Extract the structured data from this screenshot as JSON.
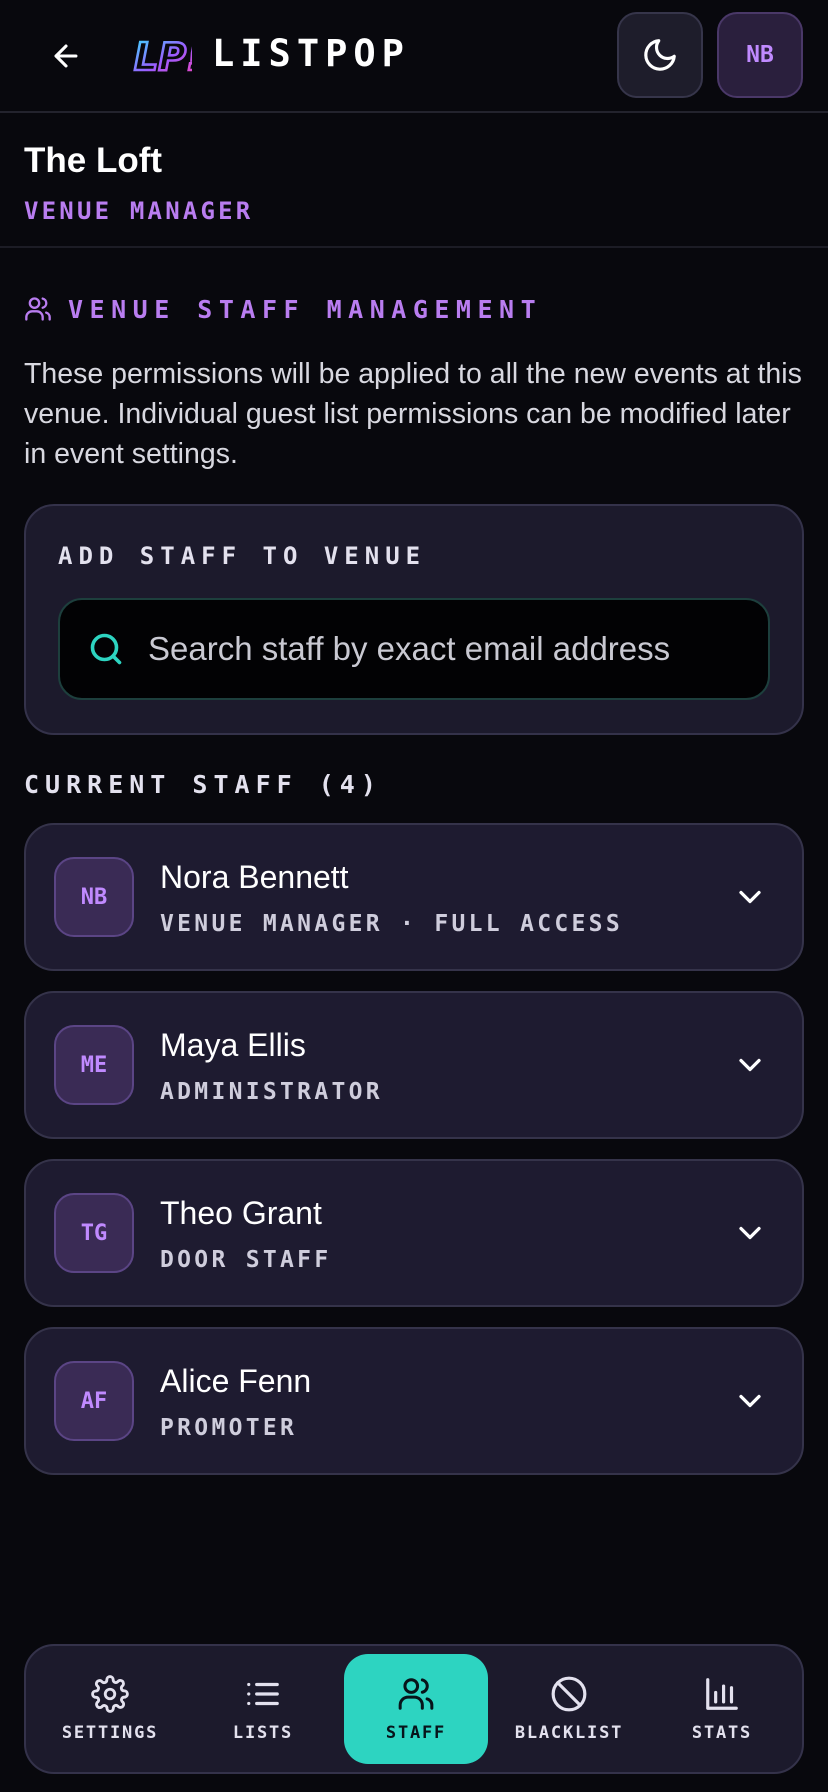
{
  "header": {
    "logo_mark": "LP!",
    "logo_text": "LISTPOP",
    "avatar_initials": "NB",
    "icons": {
      "back": "arrow-left-icon",
      "theme": "moon-icon"
    }
  },
  "venue": {
    "name": "The Loft",
    "role": "VENUE MANAGER"
  },
  "staff_section": {
    "title": "VENUE STAFF MANAGEMENT",
    "description": "These permissions will be applied to all the new events at this venue. Individual guest list permissions can be modified later in event settings.",
    "add_title": "ADD STAFF TO VENUE",
    "search_placeholder": "Search staff by exact email address",
    "current_title": "CURRENT STAFF (4)",
    "staff": [
      {
        "initials": "NB",
        "name": "Nora Bennett",
        "role": "VENUE MANAGER · FULL ACCESS"
      },
      {
        "initials": "ME",
        "name": "Maya Ellis",
        "role": "ADMINISTRATOR"
      },
      {
        "initials": "TG",
        "name": "Theo Grant",
        "role": "DOOR STAFF"
      },
      {
        "initials": "AF",
        "name": "Alice Fenn",
        "role": "PROMOTER"
      }
    ]
  },
  "nav": {
    "items": [
      {
        "label": "SETTINGS",
        "icon": "gear-icon"
      },
      {
        "label": "LISTS",
        "icon": "list-icon"
      },
      {
        "label": "STAFF",
        "icon": "users-icon",
        "active": true
      },
      {
        "label": "BLACKLIST",
        "icon": "ban-icon"
      },
      {
        "label": "STATS",
        "icon": "bar-chart-icon"
      }
    ]
  },
  "colors": {
    "background": "#08080d",
    "accent_purple": "#b97df0",
    "accent_teal": "#2dd4c1",
    "card": "#1e1b30"
  }
}
